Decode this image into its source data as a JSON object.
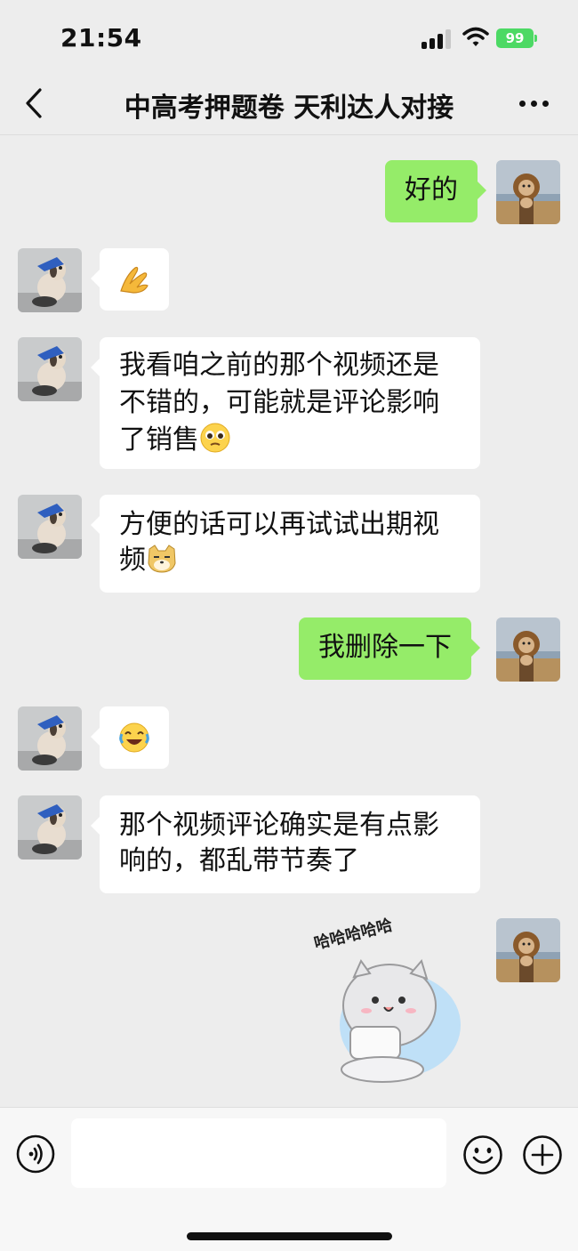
{
  "status_bar": {
    "time": "21:54",
    "battery": "99",
    "battery_color": "#4cd964"
  },
  "nav": {
    "title": "中高考押题卷  天利达人对接",
    "back_icon": "chevron-left-icon",
    "more_icon": "more-dots-icon"
  },
  "colors": {
    "background": "#ededed",
    "outgoing_bubble": "#95ec69",
    "incoming_bubble": "#ffffff"
  },
  "messages": [
    {
      "sender": "me",
      "text": "好的"
    },
    {
      "sender": "them",
      "text": "",
      "emoji": "ok-hand-emoji"
    },
    {
      "sender": "them",
      "text": "我看咱之前的那个视频还是不错的，可能就是评论影响了销售",
      "emoji": "pleading-face-emoji"
    },
    {
      "sender": "them",
      "text": "方便的话可以再试试出期视频",
      "emoji": "doge-emoji"
    },
    {
      "sender": "me",
      "text": "我删除一下"
    },
    {
      "sender": "them",
      "text": "",
      "emoji": "rolling-laughing-emoji"
    },
    {
      "sender": "them",
      "text": "那个视频评论确实是有点影响的，都乱带节奏了"
    },
    {
      "sender": "me",
      "sticker": "laughing-cat-sticker",
      "sticker_text": "哈哈哈哈哈"
    }
  ],
  "input_bar": {
    "voice_icon": "voice-icon",
    "input_value": "",
    "emoji_icon": "emoji-icon",
    "plus_icon": "plus-icon"
  }
}
